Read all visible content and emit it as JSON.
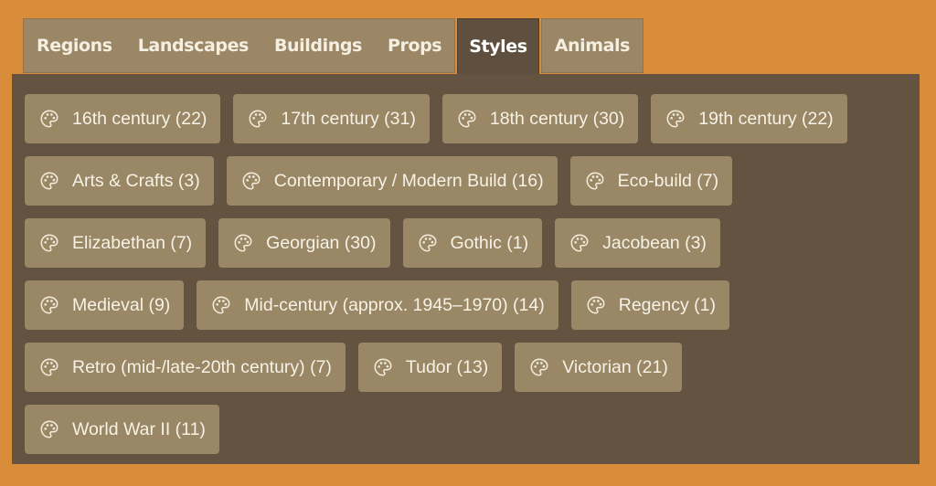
{
  "tabs": [
    {
      "label": "Regions",
      "active": false
    },
    {
      "label": "Landscapes",
      "active": false
    },
    {
      "label": "Buildings",
      "active": false
    },
    {
      "label": "Props",
      "active": false
    },
    {
      "label": "Styles",
      "active": true
    },
    {
      "label": "Animals",
      "active": false
    }
  ],
  "styles": [
    {
      "label": "16th century (22)"
    },
    {
      "label": "17th century (31)"
    },
    {
      "label": "18th century (30)"
    },
    {
      "label": "19th century (22)"
    },
    {
      "label": "Arts & Crafts (3)"
    },
    {
      "label": "Contemporary / Modern Build (16)"
    },
    {
      "label": "Eco-build (7)"
    },
    {
      "label": "Elizabethan (7)"
    },
    {
      "label": "Georgian (30)"
    },
    {
      "label": "Gothic (1)"
    },
    {
      "label": "Jacobean (3)"
    },
    {
      "label": "Medieval (9)"
    },
    {
      "label": "Mid-century (approx. 1945–1970) (14)"
    },
    {
      "label": "Regency (1)"
    },
    {
      "label": "Retro (mid-/late-20th century) (7)"
    },
    {
      "label": "Tudor (13)"
    },
    {
      "label": "Victorian (21)"
    },
    {
      "label": "World War II (11)"
    }
  ],
  "icons": {
    "chip_icon": "palette-icon"
  },
  "colors": {
    "page_background": "#d98c3a",
    "tab_background": "#9b8765",
    "active_tab_background": "#5f4f3e",
    "panel_background": "#635340",
    "chip_background": "#998766",
    "text": "#f7f2e6"
  }
}
